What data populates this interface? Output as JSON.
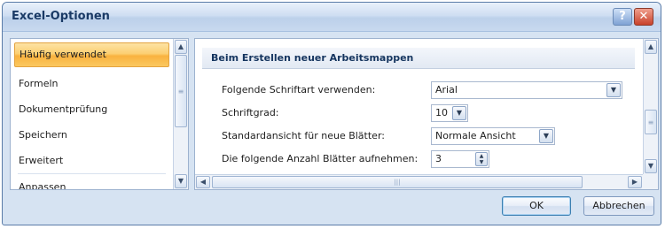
{
  "window": {
    "title": "Excel-Optionen"
  },
  "title_buttons": {
    "help": "?",
    "close": "✕"
  },
  "nav": {
    "items": [
      {
        "label": "Häufig verwendet",
        "selected": true
      },
      {
        "label": "Formeln"
      },
      {
        "label": "Dokumentprüfung"
      },
      {
        "label": "Speichern"
      },
      {
        "label": "Erweitert"
      },
      {
        "label": "Anpassen"
      }
    ]
  },
  "section": {
    "header": "Beim Erstellen neuer Arbeitsmappen",
    "options": [
      {
        "label": "Folgende Schriftart verwenden:",
        "value": "Arial",
        "control": "dropdown"
      },
      {
        "label": "Schriftgrad:",
        "value": "10",
        "control": "dropdown"
      },
      {
        "label": "Standardansicht für neue Blätter:",
        "value": "Normale Ansicht",
        "control": "dropdown"
      },
      {
        "label": "Die folgende Anzahl Blätter aufnehmen:",
        "value": "3",
        "control": "spinner"
      }
    ]
  },
  "icons": {
    "up": "scroll-up-arrow",
    "down": "scroll-down-arrow",
    "left": "scroll-left-arrow",
    "right": "scroll-right-arrow",
    "dropdown": "chevron-down"
  },
  "buttons": {
    "ok": "OK",
    "cancel": "Abbrechen"
  },
  "colors": {
    "selected_item": "#fbc860",
    "window_bg": "#d6e3f2",
    "title_text": "#1a3a66"
  }
}
